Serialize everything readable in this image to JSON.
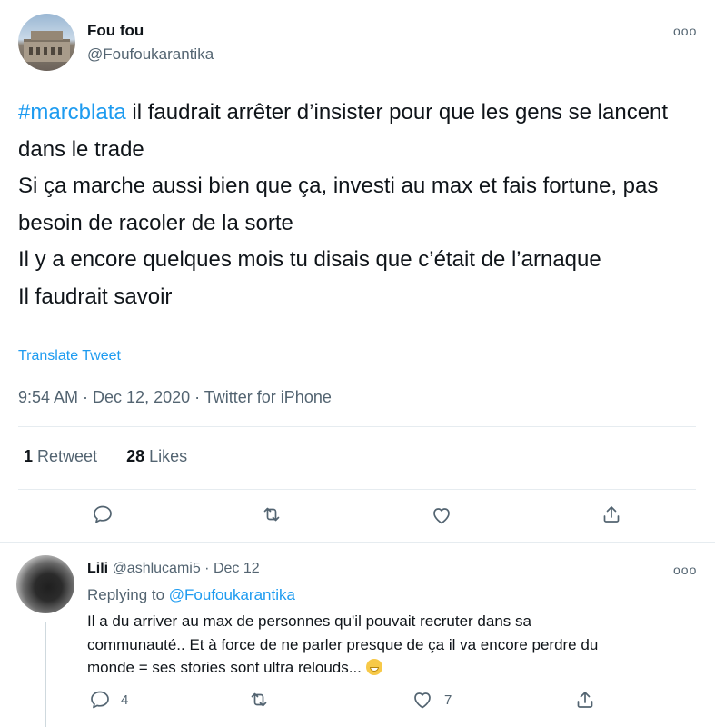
{
  "tweet": {
    "display_name": "Fou fou",
    "handle": "@Foufoukarantika",
    "hashtag": "#marcblata",
    "text_after_hashtag": " il faudrait arrêter d’insister pour que les gens se lancent dans le trade\nSi ça marche aussi bien que ça, investi au max et fais fortune, pas besoin de racoler de la sorte\nIl y a encore quelques mois tu disais que c’était de l’arnaque\nIl faudrait savoir",
    "translate_label": "Translate Tweet",
    "timestamp": "9:54 AM · Dec 12, 2020 · Twitter for iPhone",
    "retweet_count": "1",
    "retweet_label": "Retweet",
    "like_count": "28",
    "like_label": "Likes",
    "more_glyph": "ooo"
  },
  "reply": {
    "display_name": "Lili",
    "handle_date": "@ashlucami5 · Dec 12",
    "replying_prefix": "Replying to ",
    "replying_to": "@Foufoukarantika",
    "text": "Il a du arriver au max de personnes qu'il pouvait recruter dans sa communauté.. Et à force de ne parler presque de ça il va encore perdre du monde = ses stories sont ultra relouds... ",
    "reply_count": "4",
    "like_count": "7",
    "more_glyph": "ooo"
  },
  "icons": {
    "reply": "reply-icon",
    "retweet": "retweet-icon",
    "like": "heart-icon",
    "share": "share-icon",
    "emoji": "grinning-emoji"
  },
  "colors": {
    "accent": "#1d9bf0",
    "secondary_text": "#536471",
    "divider": "#e6ecf0"
  }
}
